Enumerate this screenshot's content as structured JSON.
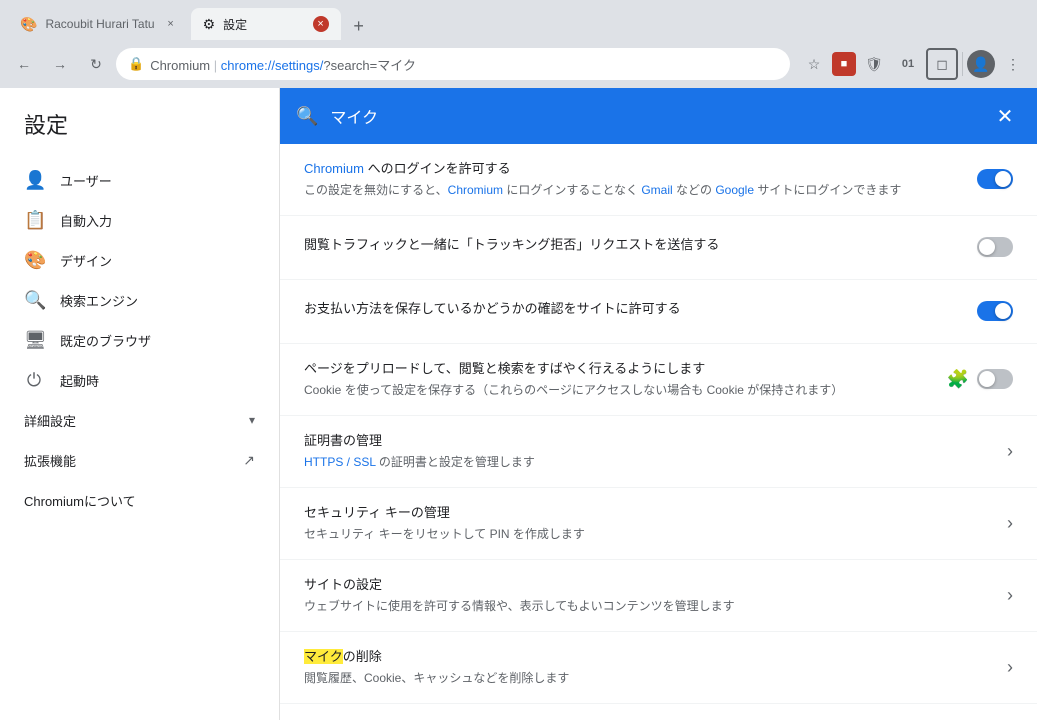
{
  "browser": {
    "tabs": [
      {
        "id": "tab1",
        "title": "Racoubit Hurari Tatu",
        "favicon": "🎨",
        "active": false,
        "close_label": "×"
      },
      {
        "id": "tab2",
        "title": "設定",
        "favicon": "⚙",
        "active": true,
        "close_label": "×"
      }
    ],
    "new_tab_label": "+",
    "nav": {
      "back": "←",
      "forward": "→",
      "reload": "↻"
    },
    "address": {
      "scheme_icon": "🔒",
      "brand": "Chromium",
      "separator": "|",
      "url_prefix": "chrome://settings/",
      "url_suffix": "?search=マイク"
    },
    "toolbar": {
      "bookmark": "☆",
      "red_square": "■",
      "shield": "🛡",
      "badge": "01",
      "extension": "◻",
      "profile": "👤",
      "menu": "⋮"
    }
  },
  "settings": {
    "title": "設定",
    "search": {
      "placeholder": "マイク",
      "value": "マイク",
      "clear_label": "✕"
    },
    "sidebar": {
      "items": [
        {
          "id": "users",
          "icon": "👤",
          "label": "ユーザー"
        },
        {
          "id": "autofill",
          "icon": "📋",
          "label": "自動入力"
        },
        {
          "id": "design",
          "icon": "🎨",
          "label": "デザイン"
        },
        {
          "id": "search-engine",
          "icon": "🔍",
          "label": "検索エンジン"
        },
        {
          "id": "default-browser",
          "icon": "🖥",
          "label": "既定のブラウザ"
        },
        {
          "id": "startup",
          "icon": "⏻",
          "label": "起動時"
        }
      ],
      "advanced": {
        "label": "詳細設定",
        "arrow": "▾"
      },
      "extensions": {
        "label": "拡張機能",
        "icon": "↗"
      },
      "about": {
        "label": "Chromiumについて"
      }
    },
    "main": {
      "items": [
        {
          "id": "chromium-login",
          "title": "Chromium へのログインを許可する",
          "desc_parts": [
            "この設定を無効にすると、",
            "Chromium",
            " にログインすることなく ",
            "Gmail",
            " などの ",
            "Google",
            " サイトにログインできます"
          ],
          "desc": "この設定を無効にすると、Chromium にログインすることなく Gmail などの Google サイトにログインできます",
          "control": "toggle",
          "toggle_on": true
        },
        {
          "id": "tracking",
          "title": "閲覧トラフィックと一緒に「トラッキング拒否」リクエストを送信する",
          "desc": "",
          "control": "toggle",
          "toggle_on": false
        },
        {
          "id": "payment",
          "title": "お支払い方法を保存しているかどうかの確認をサイトに許可する",
          "desc": "",
          "control": "toggle",
          "toggle_on": true
        },
        {
          "id": "preload",
          "title": "ページをプリロードして、閲覧と検索をすばやく行えるようにします",
          "desc": "Cookie を使って設定を保存する（これらのページにアクセスしない場合も Cookie が保持されます）",
          "control": "toggle-with-puzzle",
          "toggle_on": false,
          "has_puzzle": true
        },
        {
          "id": "certificates",
          "title": "証明書の管理",
          "desc": "HTTPS / SSL の証明書と設定を管理します",
          "control": "arrow"
        },
        {
          "id": "security-keys",
          "title": "セキュリティ キーの管理",
          "desc": "セキュリティ キーをリセットして PIN を作成します",
          "control": "arrow"
        },
        {
          "id": "site-settings",
          "title": "サイトの設定",
          "desc": "ウェブサイトに使用を許可する情報や、表示してもよいコンテンツを管理します",
          "control": "arrow"
        },
        {
          "id": "clear-data",
          "title_parts": [
            {
              "text": "マイク",
              "highlight": true
            },
            {
              "text": "の削除",
              "highlight": false
            }
          ],
          "title_prefix_highlight": "マイク",
          "title_suffix": "の削除",
          "desc": "閲覧履歴、Cookie、キャッシュなどを削除します",
          "control": "arrow",
          "has_highlight": true
        }
      ]
    }
  }
}
